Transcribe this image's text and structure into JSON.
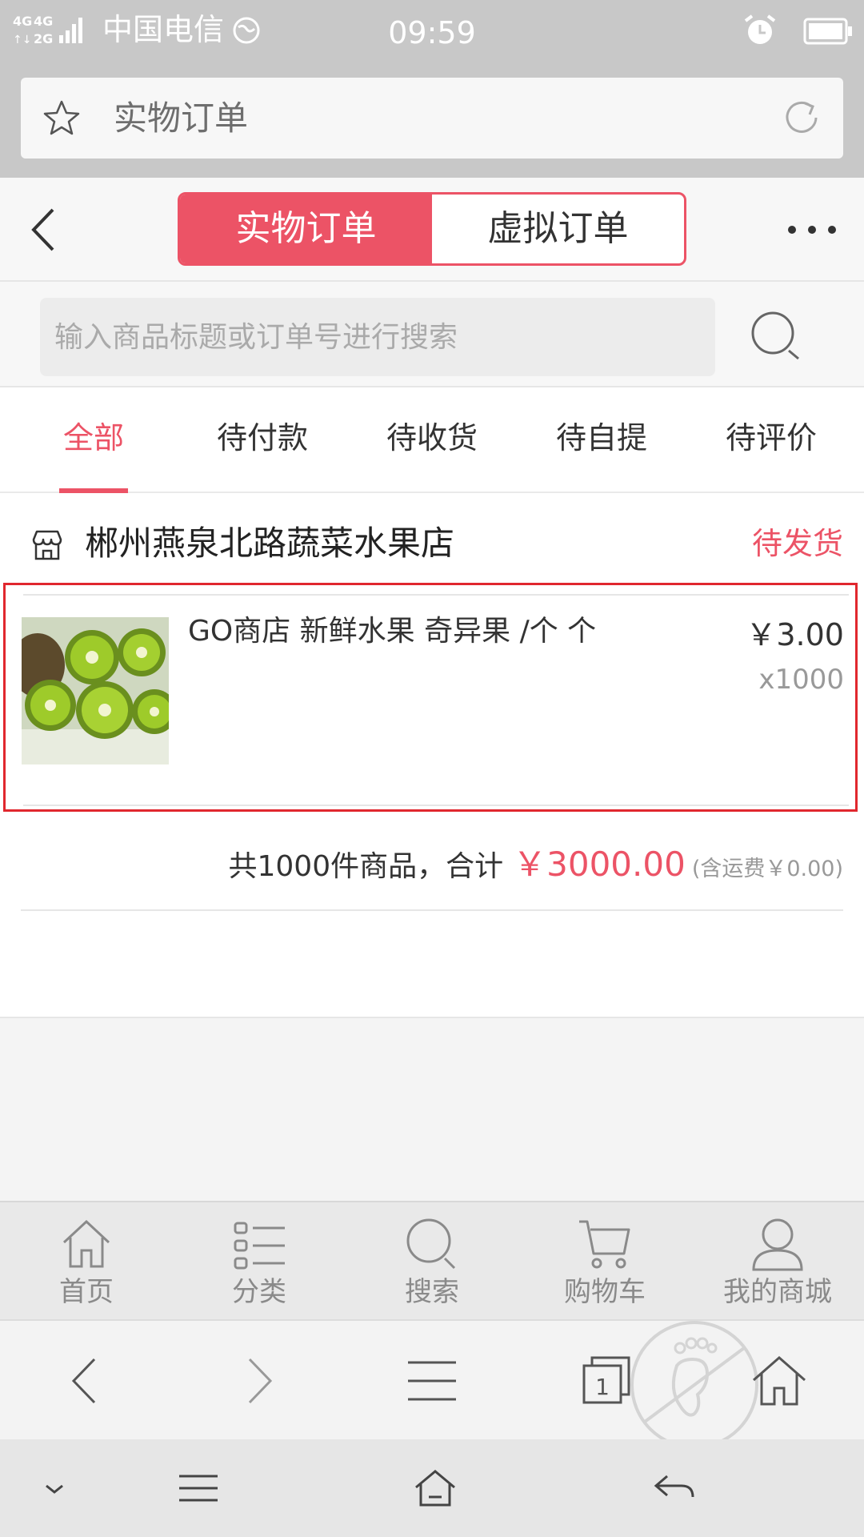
{
  "status_bar": {
    "network": "4G 4G 2G",
    "carrier": "中国电信",
    "time": "09:59"
  },
  "url_bar": {
    "title": "实物订单"
  },
  "header": {
    "tabs": [
      {
        "label": "实物订单",
        "active": true
      },
      {
        "label": "虚拟订单",
        "active": false
      }
    ],
    "accent_color": "#ec5366"
  },
  "search": {
    "placeholder": "输入商品标题或订单号进行搜索"
  },
  "filter_tabs": [
    {
      "label": "全部",
      "active": true
    },
    {
      "label": "待付款",
      "active": false
    },
    {
      "label": "待收货",
      "active": false
    },
    {
      "label": "待自提",
      "active": false
    },
    {
      "label": "待评价",
      "active": false
    }
  ],
  "order": {
    "shop_name": "郴州燕泉北路蔬菜水果店",
    "status": "待发货",
    "item": {
      "title": "GO商店 新鲜水果 奇异果 /个 个",
      "price": "￥3.00",
      "quantity": "x1000",
      "image": "kiwi-fruit-photo"
    },
    "summary": {
      "text": "共1000件商品，合计",
      "total": "￥3000.00",
      "shipping": "(含运费￥0.00)"
    }
  },
  "bottom_nav": [
    {
      "label": "首页",
      "icon": "home-icon"
    },
    {
      "label": "分类",
      "icon": "category-list-icon"
    },
    {
      "label": "搜索",
      "icon": "search-icon"
    },
    {
      "label": "购物车",
      "icon": "cart-icon"
    },
    {
      "label": "我的商城",
      "icon": "user-icon"
    }
  ],
  "browser_toolbar": {
    "tab_count": "1",
    "icons": [
      "back-arrow-icon",
      "forward-arrow-icon",
      "menu-icon",
      "tabs-icon",
      "home-icon",
      "footprint-icon"
    ]
  },
  "system_nav": {
    "icons": [
      "chevron-down-icon",
      "menu-icon",
      "home-icon",
      "back-icon"
    ]
  }
}
